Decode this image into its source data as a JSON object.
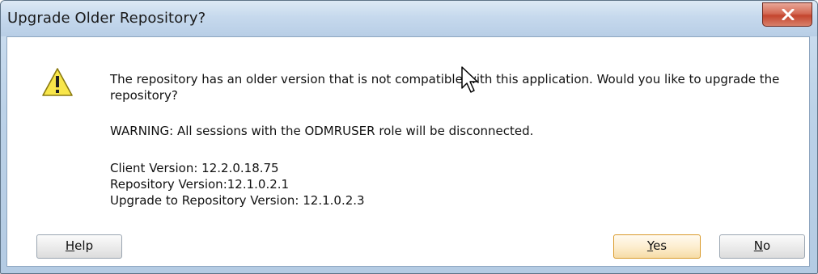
{
  "window": {
    "title": "Upgrade Older Repository?"
  },
  "titlebar": {
    "close_icon": "close-icon"
  },
  "dialog": {
    "icon": "warning-icon",
    "message": "The repository has an older version that is not compatible with this application.  Would you like to upgrade the repository?",
    "warning": "WARNING: All sessions with the ODMRUSER role will be disconnected.",
    "client_version": "Client Version: 12.2.0.18.75",
    "repository_version": "Repository Version:12.1.0.2.1",
    "upgrade_version": "Upgrade to Repository Version: 12.1.0.2.3"
  },
  "buttons": {
    "help_mnemonic": "H",
    "help_rest": "elp",
    "yes_mnemonic": "Y",
    "yes_rest": "es",
    "no_mnemonic": "N",
    "no_rest": "o"
  },
  "colors": {
    "close_button": "#c4452e",
    "default_button_border": "#d99a2a",
    "titlebar": "#c6d9ed"
  }
}
